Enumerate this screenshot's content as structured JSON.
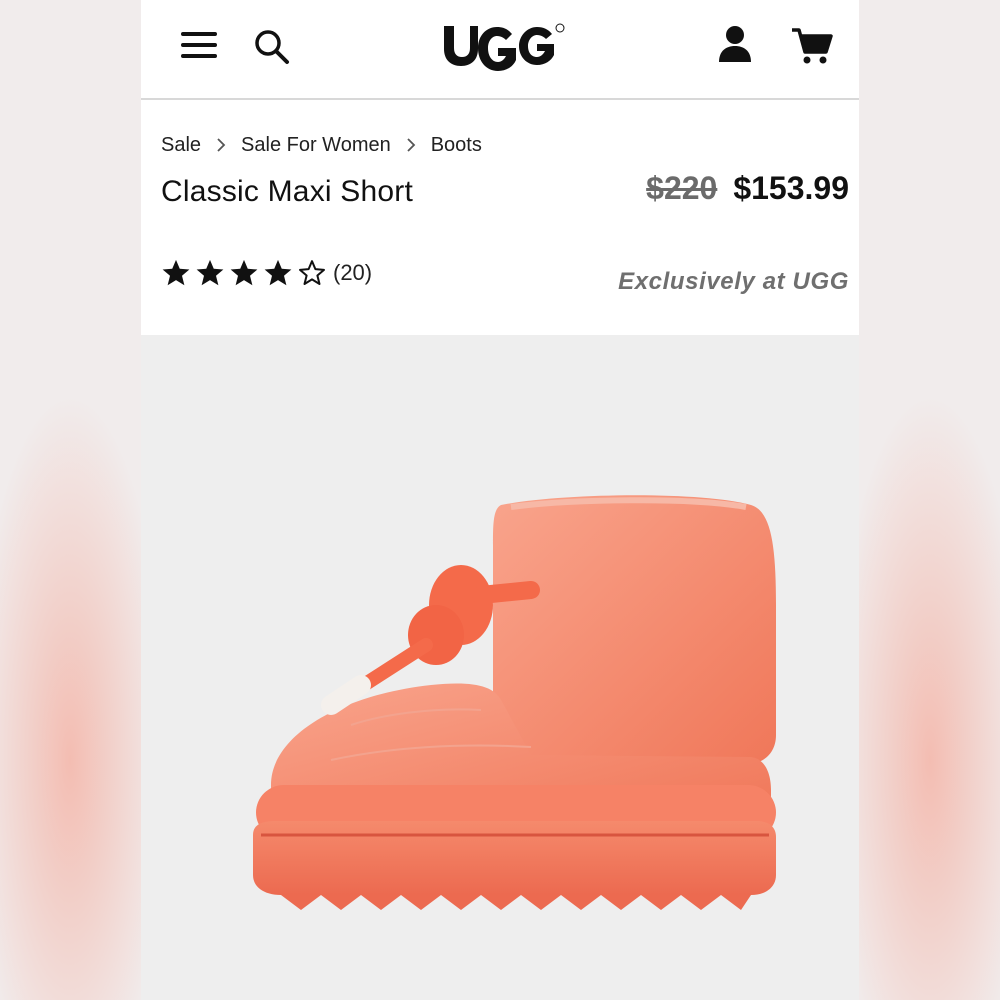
{
  "header": {
    "menu_icon": "hamburger-menu-icon",
    "search_icon": "search-icon",
    "logo_text": "UGG",
    "account_icon": "account-icon",
    "cart_icon": "cart-icon"
  },
  "breadcrumb": [
    "Sale",
    "Sale For Women",
    "Boots"
  ],
  "product": {
    "title": "Classic Maxi Short",
    "original_price": "$220",
    "sale_price": "$153.99",
    "rating": 4,
    "rating_max": 5,
    "review_count": "(20)",
    "exclusive_label": "Exclusively at UGG",
    "image_color": "#f48466"
  },
  "colors": {
    "text": "#111111",
    "muted": "#6b6b6b",
    "image_bg": "#eeeeee",
    "boot": "#f48466"
  }
}
